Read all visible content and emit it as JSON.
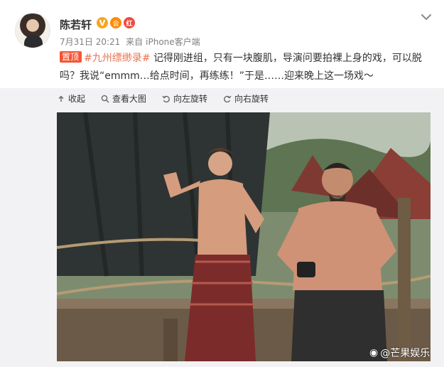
{
  "post": {
    "author": "陈若轩",
    "badges": {
      "verified": "V",
      "member": "会",
      "hot": "红"
    },
    "timestamp": "7月31日 20:21",
    "source_prefix": "来自",
    "source": "iPhone客户端",
    "pin_label": "置顶",
    "topic": "#九州缥缈录#",
    "text": "记得刚进组，只有一块腹肌，导演问要拍裸上身的戏，可以脱吗？我说“emmm…给点时间，再练练！”于是……迎来晚上这一场戏～"
  },
  "toolbar": {
    "collapse": "收起",
    "view_large": "查看大图",
    "rotate_left": "向左旋转",
    "rotate_right": "向右旋转"
  },
  "watermark": "@芒果娱乐",
  "icons": {
    "menu": "chevron-down-icon",
    "collapse": "collapse-icon",
    "view_large": "magnify-icon",
    "rotate_left": "rotate-left-icon",
    "rotate_right": "rotate-right-icon"
  },
  "colors": {
    "link": "#eb7350",
    "pin": "#f45535",
    "meta": "#808080",
    "media_bg": "#f2f2f5"
  }
}
